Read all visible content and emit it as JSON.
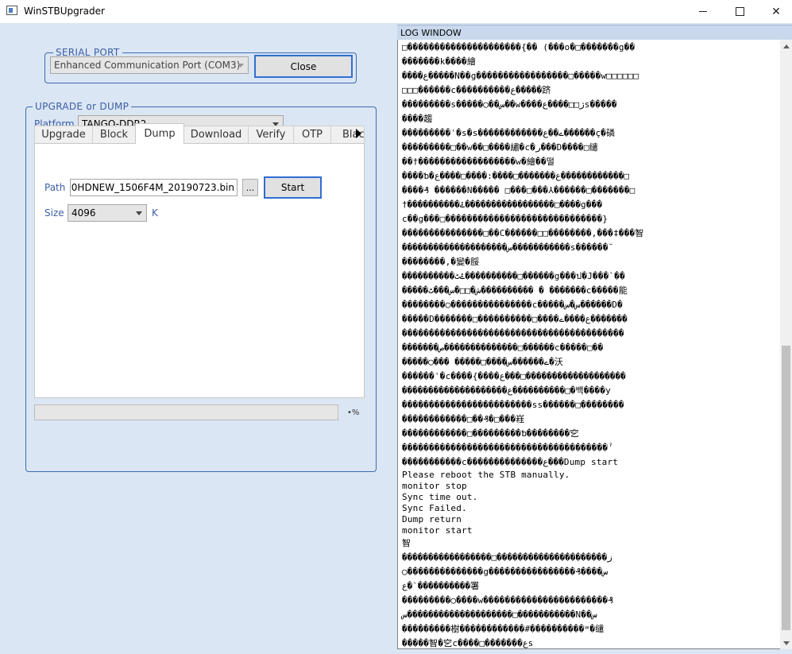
{
  "window": {
    "title": "WinSTBUpgrader",
    "minimize_icon": "minimize-icon",
    "maximize_icon": "maximize-icon",
    "close_icon": "close-icon"
  },
  "serial_port": {
    "legend": "SERIAL PORT",
    "port_selected": "Enhanced Communication Port (COM3)",
    "close_button": "Close"
  },
  "upgrade": {
    "legend": "UPGRADE or DUMP",
    "platform_label": "Platform",
    "platform_selected": "TANGO-DDR2",
    "tabs": [
      {
        "label": "Upgrade",
        "active": false
      },
      {
        "label": "Block",
        "active": false
      },
      {
        "label": "Dump",
        "active": true
      },
      {
        "label": "Download",
        "active": false
      },
      {
        "label": "Verify",
        "active": false
      },
      {
        "label": "OTP",
        "active": false
      },
      {
        "label": "Blac",
        "active": false
      }
    ],
    "dump": {
      "path_label": "Path",
      "path_value": "0HDNEW_1506F4M_20190723.bin",
      "browse_button": "...",
      "start_button": "Start",
      "size_label": "Size",
      "size_selected": "4096",
      "size_unit": "K"
    },
    "progress": {
      "value": 0,
      "percent_text": "•%"
    }
  },
  "log": {
    "header": "LOG WINDOW",
    "lines": [
      "□���������������������{�� (���o�□�������g��",
      "�������k����繪",
      "����ع�����N��g�����������������□�����w□□□□□□",
      "□□□������c����������ع�����跻",
      "���������s�����◯��س��w����ژ□□����عs�����",
      "����趨",
      "���������ʿ�s�s������������ے��ع������ç�磷",
      "���������□��w��□����繡�c�ر���D����□缱",
      "��†������������������w�繪��떨",
      "����ƅ�ع�������□����:����□����ع������������□",
      "����₰ ������N����� □���□���⅄������□�������□",
      "†����������ۓ�����������������□����g���",
      "c��g���□�����������������������������}",
      "���������������□��C������□□��������,���‡���智",
      "��������������������س�����������s������˘",
      "��������,�變�脮",
      "����������ۓٹ����������□������g���ป�J���`��",
      "�����ش�□□�س���ٹ���������� � �������c�����能",
      "��������◯���������������c�����س�س������D�",
      "�����D�������□����������□����ع����ے�������",
      "�����������������������������������������",
      "�������ص��������������□������c�����□��",
      "�����◯��� �����□����ے������س�沃",
      "������ʿ�c����{����ع���□�������������������",
      "��������������������ع����������□�백����y",
      "������������������������ss������□��������",
      "������������□��₰�□���嵀",
      "������������□���������ƅ��������穵",
      "��������������������������������������ˀ",
      "�����������c��������������ع���Dump start",
      "Please reboot the STB manually.",
      "monitor stop",
      "Sync time out.",
      "Sync Failed.",
      "Dump return",
      "monitor start",
      "智",
      "�����������������□���������������������ز",
      "◯��������������g����������������₰����س",
      "ع�`����������署",
      "���������◯����w�����������������������₰",
      "س��������������������□�����������N��س",
      "���������樹������������#����������ʷ�缱",
      "�����智�穵c����□�������عs"
    ]
  },
  "colors": {
    "background": "#dbe6f4",
    "group_border": "#3b6bb5",
    "legend_text": "#3b5ea3"
  }
}
